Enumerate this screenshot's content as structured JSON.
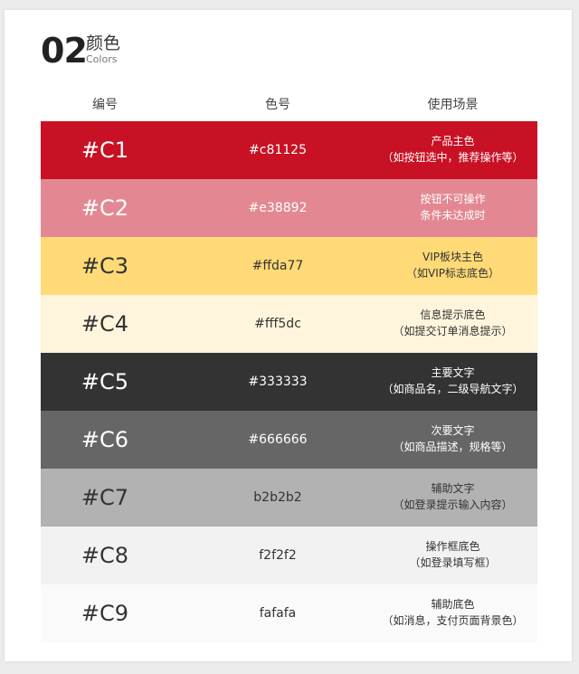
{
  "section": {
    "number": "02",
    "title_cn": "颜色",
    "title_en": "Colors"
  },
  "table": {
    "headers": [
      "编号",
      "色号",
      "使用场景"
    ],
    "rows": [
      {
        "code": "#C1",
        "hex": "#c81125",
        "usage": [
          "产品主色",
          "（如按钮选中，推荐操作等）"
        ],
        "bg": "#c81125",
        "fg": "#ffffff"
      },
      {
        "code": "#C2",
        "hex": "#e38892",
        "usage": [
          "按钮不可操作",
          "条件未达成时"
        ],
        "bg": "#e38892",
        "fg": "#ffffff"
      },
      {
        "code": "#C3",
        "hex": "#ffda77",
        "usage": [
          "VIP板块主色",
          "（如VIP标志底色）"
        ],
        "bg": "#ffda77",
        "fg": "#333333"
      },
      {
        "code": "#C4",
        "hex": "#fff5dc",
        "usage": [
          "信息提示底色",
          "（如提交订单消息提示）"
        ],
        "bg": "#fff5dc",
        "fg": "#333333"
      },
      {
        "code": "#C5",
        "hex": "#333333",
        "usage": [
          "主要文字",
          "（如商品名，二级导航文字）"
        ],
        "bg": "#333333",
        "fg": "#ffffff"
      },
      {
        "code": "#C6",
        "hex": "#666666",
        "usage": [
          "次要文字",
          "（如商品描述，规格等）"
        ],
        "bg": "#666666",
        "fg": "#ffffff"
      },
      {
        "code": "#C7",
        "hex": "b2b2b2",
        "usage": [
          "辅助文字",
          "（如登录提示输入内容）"
        ],
        "bg": "#b2b2b2",
        "fg": "#333333"
      },
      {
        "code": "#C8",
        "hex": "f2f2f2",
        "usage": [
          "操作框底色",
          "（如登录填写框）"
        ],
        "bg": "#f2f2f2",
        "fg": "#333333"
      },
      {
        "code": "#C9",
        "hex": "fafafa",
        "usage": [
          "辅助底色",
          "（如消息，支付页面背景色）"
        ],
        "bg": "#fafafa",
        "fg": "#333333"
      }
    ]
  }
}
